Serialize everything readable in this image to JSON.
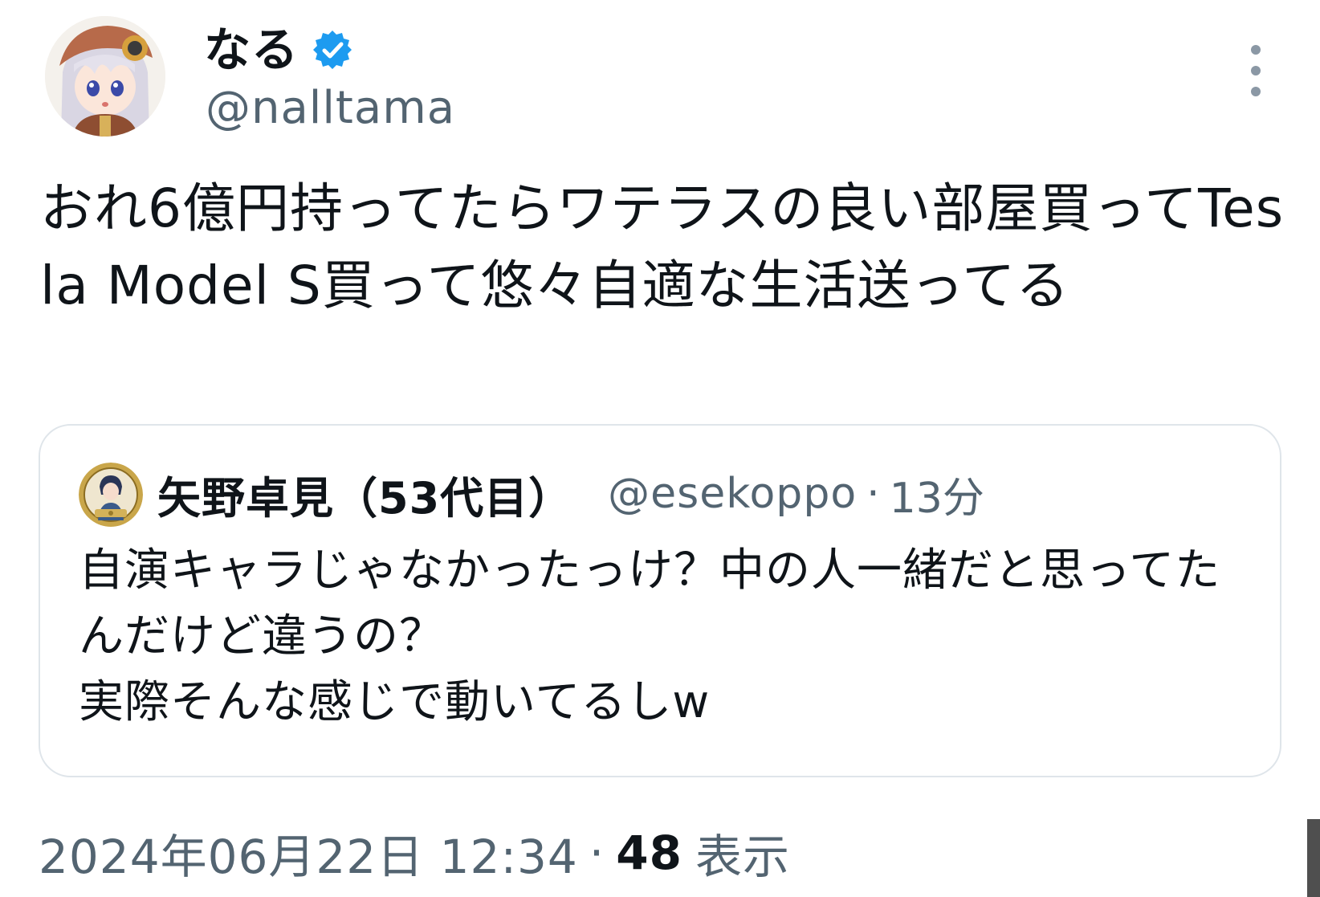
{
  "author": {
    "display_name": "なる",
    "handle": "@nalltama",
    "avatar_icon": "anime-girl-avatar",
    "verified_icon": "verified-badge-icon",
    "verified_color": "#1d9bf0"
  },
  "post": {
    "text": "おれ6億円持ってたらワテラスの良い部屋買ってTesla Model S買って悠々自適な生活送ってる"
  },
  "quoted_post": {
    "display_name": "矢野卓見（53代目）",
    "handle": "@esekoppo",
    "separator": "·",
    "time": "13分",
    "text": "自演キャラじゃなかったっけ？中の人一緒だと思ってたんだけど違うの？\n実際そんな感じで動いてるしw",
    "avatar_icon": "gold-framed-avatar"
  },
  "meta": {
    "timestamp": "2024年06月22日 12:34",
    "separator": "·",
    "view_count": "48",
    "view_label": "表示"
  },
  "colors": {
    "text_primary": "#0f1419",
    "text_secondary": "#536471",
    "border": "#dfe5ea",
    "accent": "#1d9bf0"
  }
}
